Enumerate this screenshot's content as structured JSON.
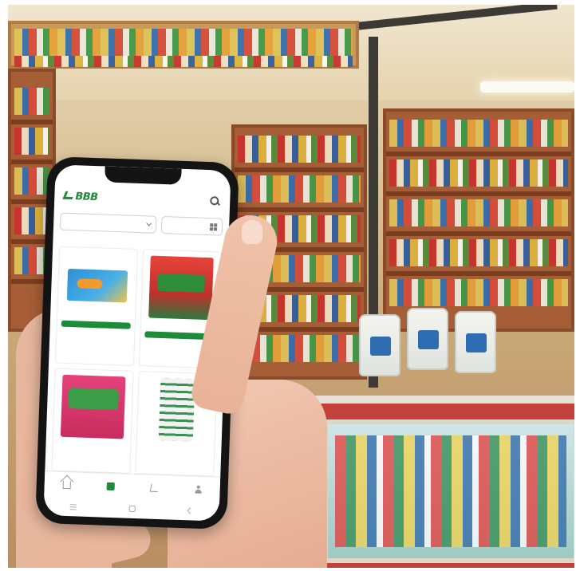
{
  "app": {
    "logo_text": "BBB"
  },
  "filters": {
    "category_placeholder": "",
    "sort_label": ""
  },
  "results_text": "",
  "products": [
    {
      "image": "blue-package",
      "brand": "",
      "name": "",
      "price": "",
      "unit": "",
      "button": ""
    },
    {
      "image": "red-package",
      "brand": "",
      "name": "",
      "price": "",
      "unit": "",
      "button": ""
    },
    {
      "image": "pink-package",
      "brand": "",
      "name": "",
      "price": "",
      "unit": "",
      "button": ""
    },
    {
      "image": "carton",
      "brand": "",
      "name": "",
      "price": "",
      "unit": "",
      "button": ""
    }
  ],
  "bottom_nav": [
    {
      "icon": "home-icon",
      "label": "",
      "active": false
    },
    {
      "icon": "bag-icon",
      "label": "",
      "active": true
    },
    {
      "icon": "cart-icon",
      "label": "",
      "active": false
    },
    {
      "icon": "user-icon",
      "label": "",
      "active": false
    }
  ],
  "colors": {
    "brand_green": "#1f8a3a"
  }
}
